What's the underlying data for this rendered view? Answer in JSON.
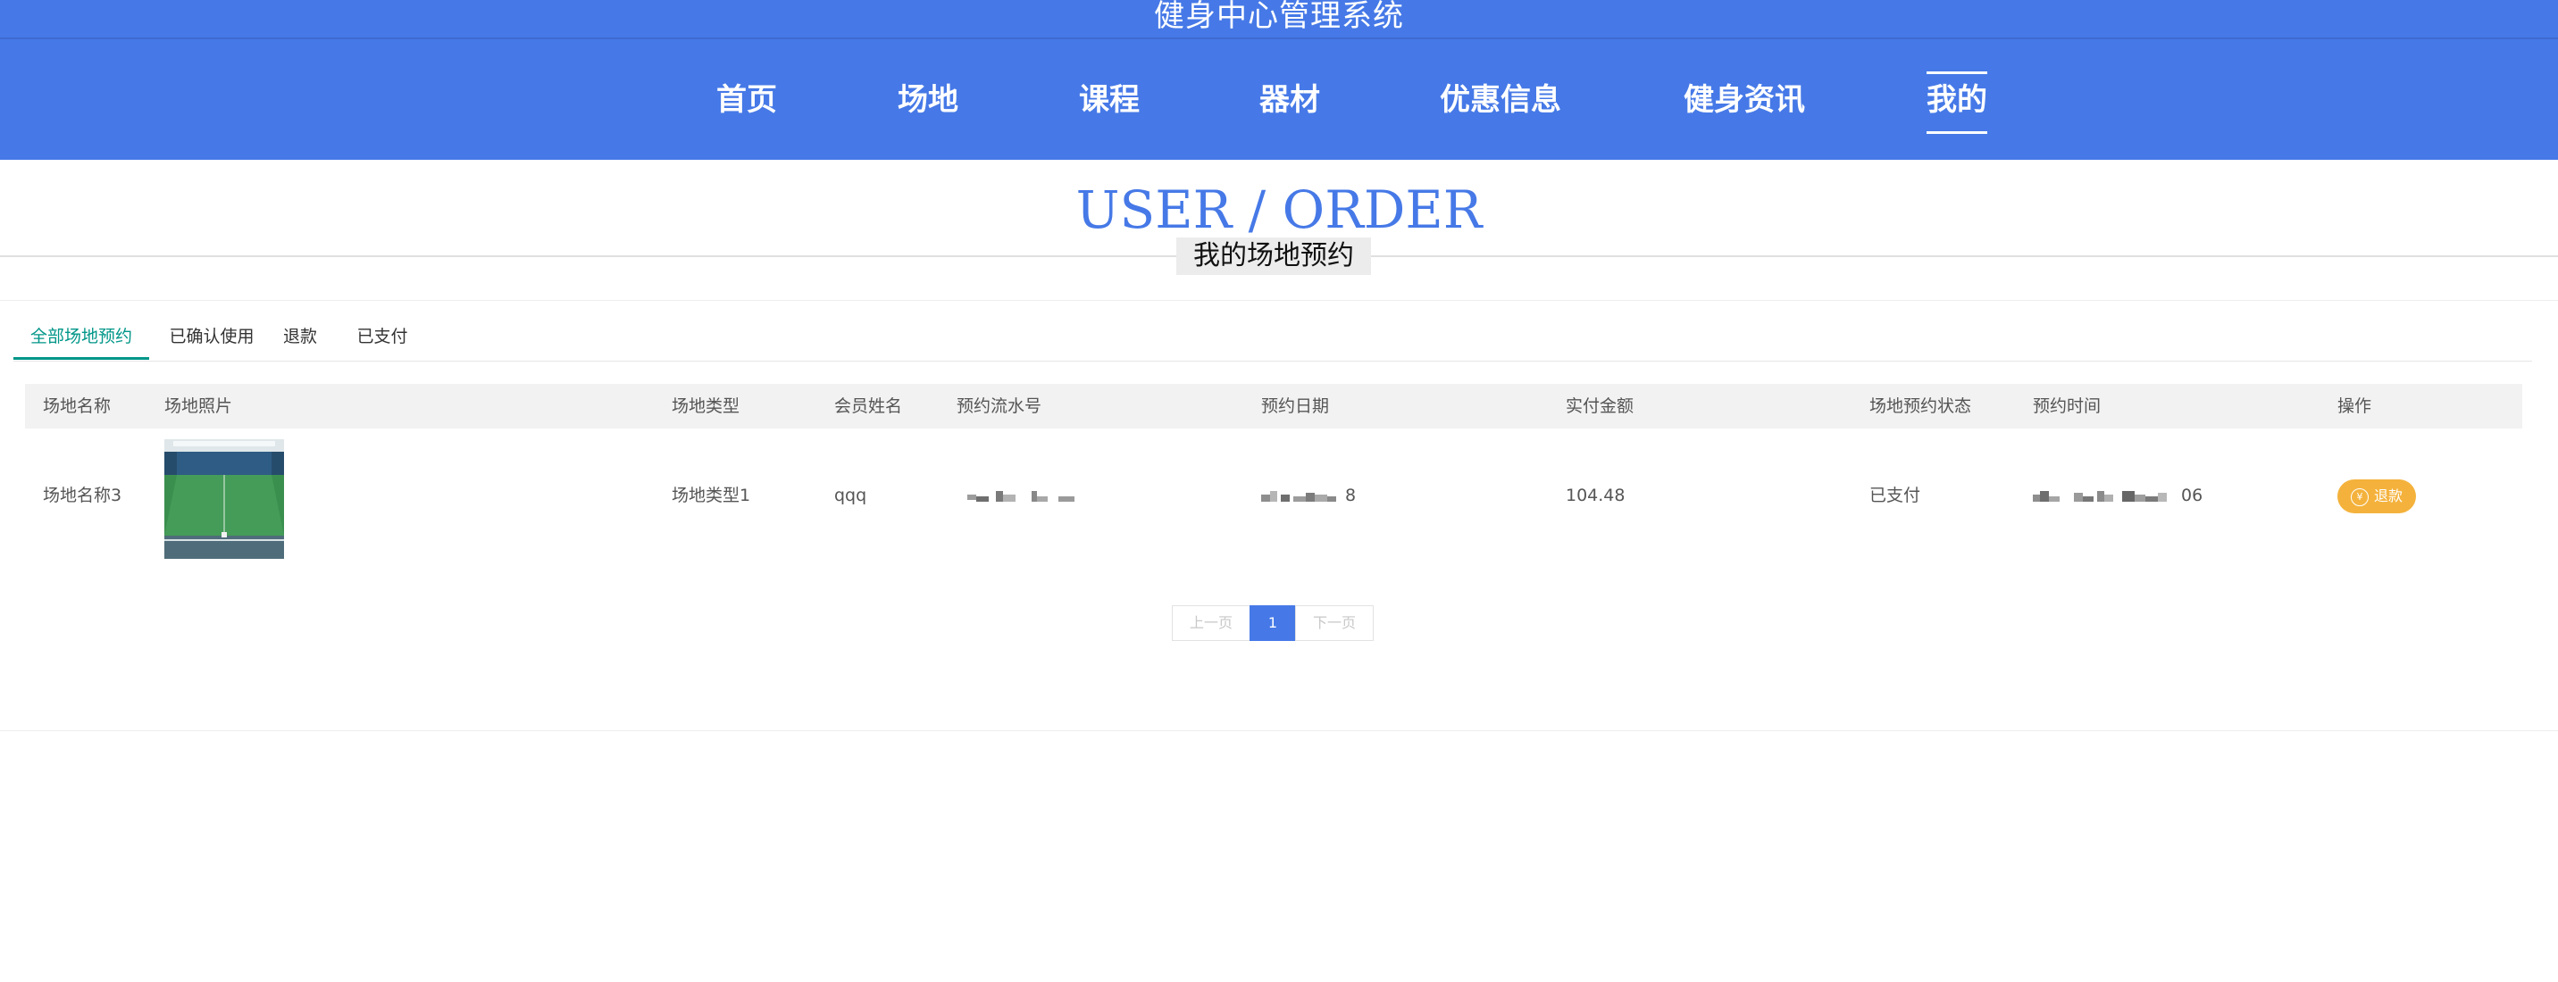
{
  "app": {
    "title": "健身中心管理系统"
  },
  "nav": {
    "items": [
      {
        "label": "首页"
      },
      {
        "label": "场地"
      },
      {
        "label": "课程"
      },
      {
        "label": "器材"
      },
      {
        "label": "优惠信息"
      },
      {
        "label": "健身资讯"
      },
      {
        "label": "我的",
        "active": true
      }
    ]
  },
  "heading": {
    "en": "USER / ORDER",
    "cn": "我的场地预约"
  },
  "tabs": [
    {
      "label": "全部场地预约",
      "active": true
    },
    {
      "label": "已确认使用"
    },
    {
      "label": "退款"
    },
    {
      "label": "已支付"
    }
  ],
  "table": {
    "headers": [
      "场地名称",
      "场地照片",
      "场地类型",
      "会员姓名",
      "预约流水号",
      "预约日期",
      "实付金额",
      "场地预约状态",
      "预约时间",
      "操作"
    ],
    "rows": [
      {
        "name": "场地名称3",
        "type": "场地类型1",
        "member": "qqq",
        "serial_tail": "",
        "date_tail": "8",
        "amount": "104.48",
        "status": "已支付",
        "time_tail": "06",
        "action": "退款",
        "action_icon": "yen-icon"
      }
    ]
  },
  "pagination": {
    "prev": "上一页",
    "current": "1",
    "next": "下一页"
  },
  "colors": {
    "primary": "#4679e7",
    "tab_active": "#009688",
    "refund": "#f4b23c"
  }
}
